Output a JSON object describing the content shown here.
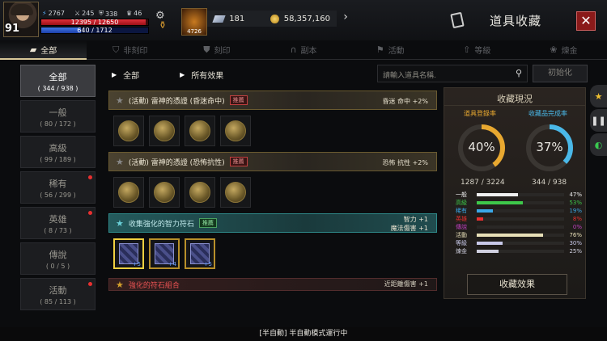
{
  "player": {
    "level": "91",
    "stat1": "2767",
    "stat2": "245",
    "stat3": "338",
    "stat4": "46",
    "hp": "12395 / 12650",
    "hp_ratio": 0.98,
    "mp": "640 / 1712",
    "mp_ratio": 0.37,
    "skill_timer": "4726"
  },
  "currency": {
    "gems": "181",
    "gold": "58,357,160"
  },
  "window": {
    "title": "道具收藏",
    "close_icon": "✕"
  },
  "tabs": [
    {
      "label": "全部",
      "icon": "square-icon"
    },
    {
      "label": "非刻印",
      "icon": "shield-icon"
    },
    {
      "label": "刻印",
      "icon": "stamp-icon"
    },
    {
      "label": "副本",
      "icon": "arch-icon"
    },
    {
      "label": "活動",
      "icon": "flag-icon"
    },
    {
      "label": "等級",
      "icon": "level-icon"
    },
    {
      "label": "煉金",
      "icon": "alchemy-icon"
    }
  ],
  "categories": [
    {
      "name": "全部",
      "count": "( 344 / 938 )",
      "new": false
    },
    {
      "name": "一般",
      "count": "( 80 / 172 )",
      "new": false
    },
    {
      "name": "高級",
      "count": "( 99 / 189 )",
      "new": false
    },
    {
      "name": "稀有",
      "count": "( 56 / 299 )",
      "new": true
    },
    {
      "name": "英雄",
      "count": "( 8 / 73 )",
      "new": true
    },
    {
      "name": "傳說",
      "count": "( 0 / 5 )",
      "new": false
    },
    {
      "name": "活動",
      "count": "( 85 / 113 )",
      "new": true
    }
  ],
  "filters": {
    "f1": "全部",
    "f2": "所有效果"
  },
  "search": {
    "placeholder": "請輸入道具名稱.",
    "reset": "初始化"
  },
  "collections": [
    {
      "title": "(活動) 雷神的憑證 (昏迷命中)",
      "tag": "推薦",
      "effect": "昏迷 命中 +2%"
    },
    {
      "title": "(活動) 雷神的憑證 (恐怖抗性)",
      "tag": "推薦",
      "effect": "恐怖 抗性 +2%"
    },
    {
      "title": "收集強化的智力符石",
      "tag": "推薦",
      "effect1": "智力 +1",
      "effect2": "魔法傷害 +1",
      "stones": [
        "+5",
        "+4",
        "+5"
      ]
    },
    {
      "title": "強化的符石組合",
      "effect": "近距離傷害 +1"
    }
  ],
  "summary": {
    "title": "收藏現況",
    "reg_label": "道具登錄率",
    "reg_value": "40%",
    "reg_ratio": 0.4,
    "reg_count": "1287 / 3224",
    "comp_label": "收藏品完成率",
    "comp_value": "37%",
    "comp_ratio": 0.37,
    "comp_count": "344 / 938",
    "rows": [
      {
        "label": "一般",
        "pct": "47%",
        "ratio": 0.47,
        "color": "#f0f0f0"
      },
      {
        "label": "高級",
        "pct": "53%",
        "ratio": 0.53,
        "color": "#3ec84a"
      },
      {
        "label": "稀有",
        "pct": "19%",
        "ratio": 0.19,
        "color": "#3aa8e8"
      },
      {
        "label": "英雄",
        "pct": "8%",
        "ratio": 0.08,
        "color": "#e83030"
      },
      {
        "label": "傳說",
        "pct": "0%",
        "ratio": 0.0,
        "color": "#c040c0"
      },
      {
        "label": "活動",
        "pct": "76%",
        "ratio": 0.76,
        "color": "#e8e0b8"
      },
      {
        "label": "等級",
        "pct": "30%",
        "ratio": 0.3,
        "color": "#c8c8e8"
      },
      {
        "label": "煉金",
        "pct": "25%",
        "ratio": 0.25,
        "color": "#d0d0e0"
      }
    ],
    "button": "收藏效果"
  },
  "status": "[半自動] 半自動模式運行中",
  "colors": {
    "reg_arc": "#e8a830",
    "comp_arc": "#4ab8e8"
  }
}
